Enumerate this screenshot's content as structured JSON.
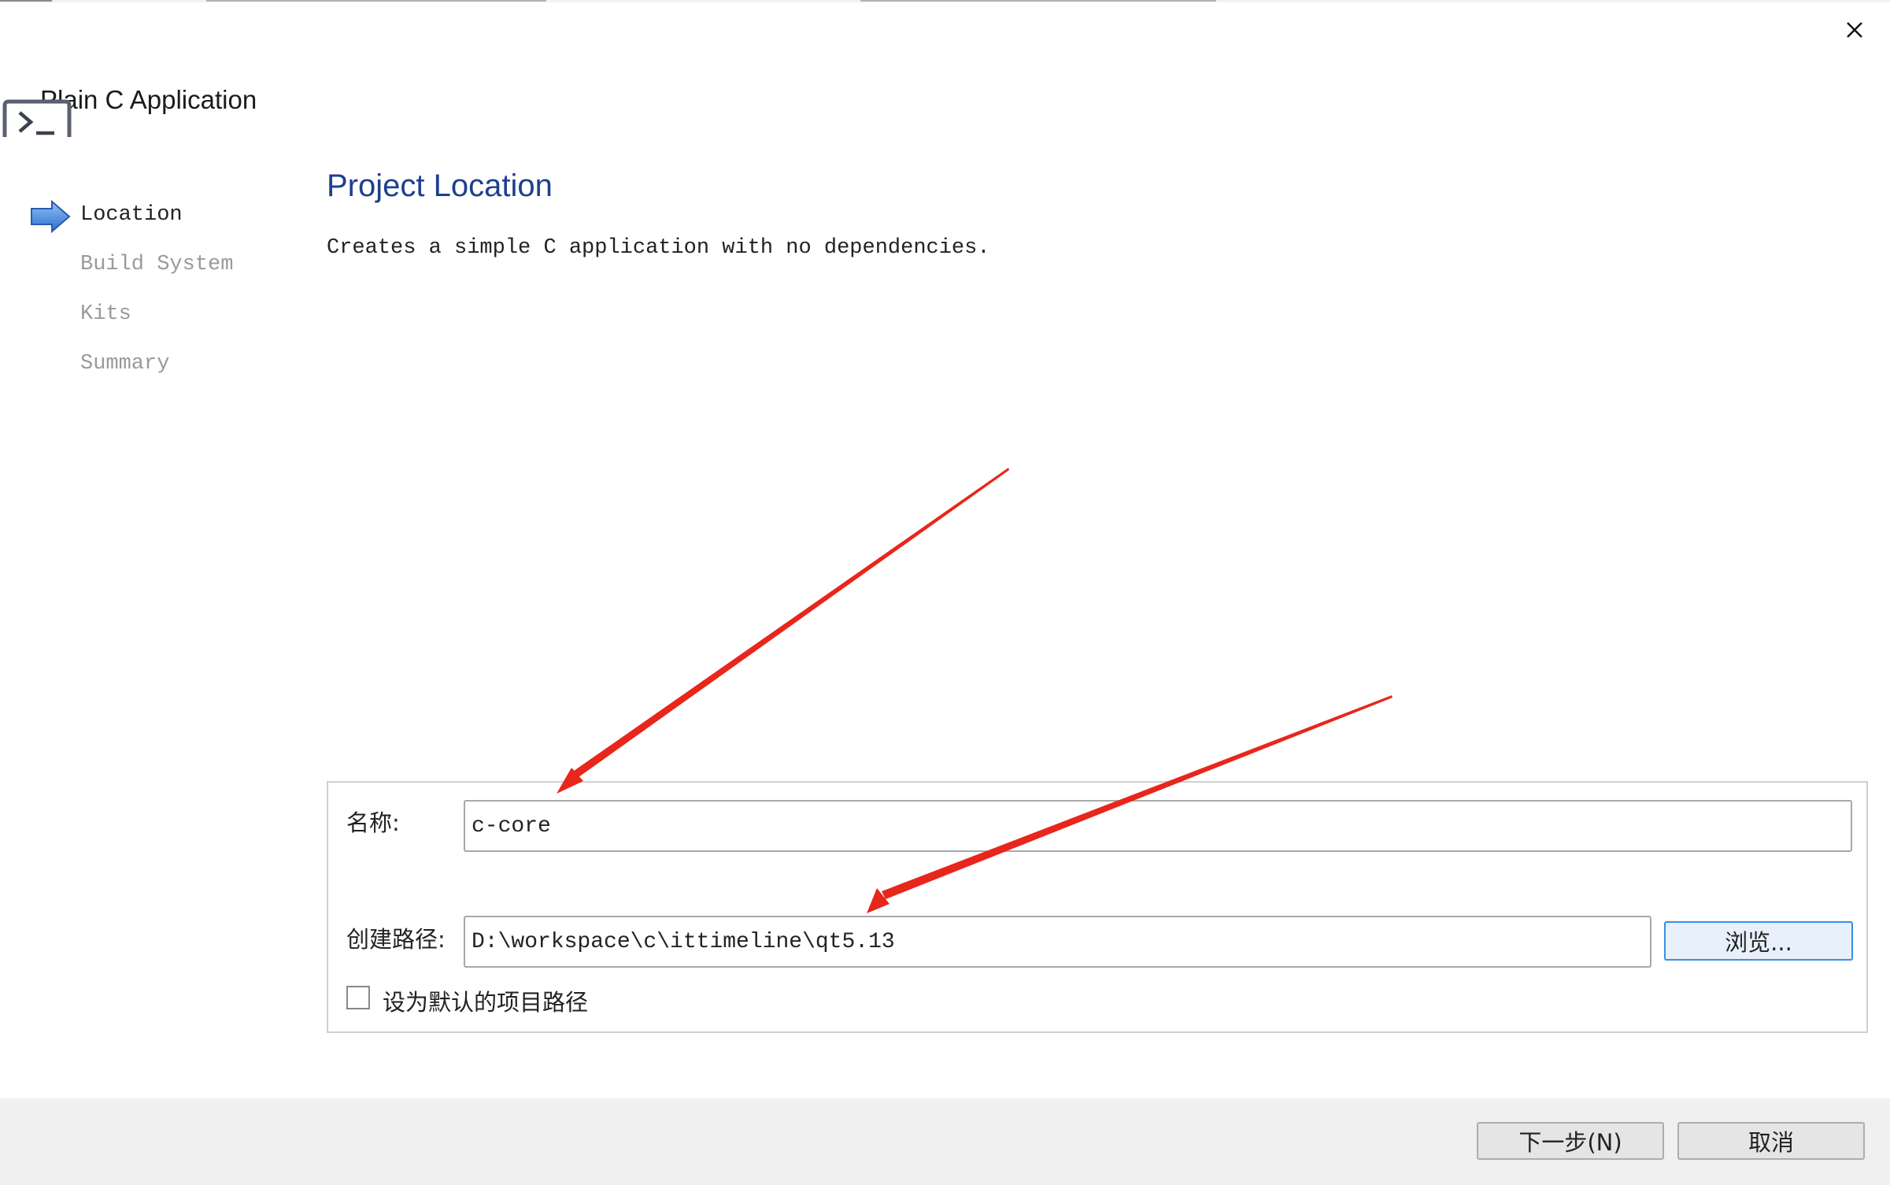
{
  "window": {
    "title": "Plain C Application",
    "close_icon": "close-icon"
  },
  "steps": [
    {
      "label": "Location",
      "state": "active"
    },
    {
      "label": "Build System",
      "state": "inactive"
    },
    {
      "label": "Kits",
      "state": "inactive"
    },
    {
      "label": "Summary",
      "state": "inactive"
    }
  ],
  "page": {
    "heading": "Project Location",
    "description": "Creates a simple C application with no dependencies."
  },
  "form": {
    "name_label": "名称:",
    "name_value": "c-core",
    "path_label": "创建路径:",
    "path_value": "D:\\workspace\\c\\ittimeline\\qt5.13",
    "browse_label": "浏览...",
    "default_checkbox_label": "设为默认的项目路径",
    "default_checked": false
  },
  "footer": {
    "next_label": "下一步(N)",
    "cancel_label": "取消"
  },
  "colors": {
    "heading": "#1e3f8c",
    "annotation_arrow": "#e8261c",
    "browse_border": "#3a8ee6"
  }
}
